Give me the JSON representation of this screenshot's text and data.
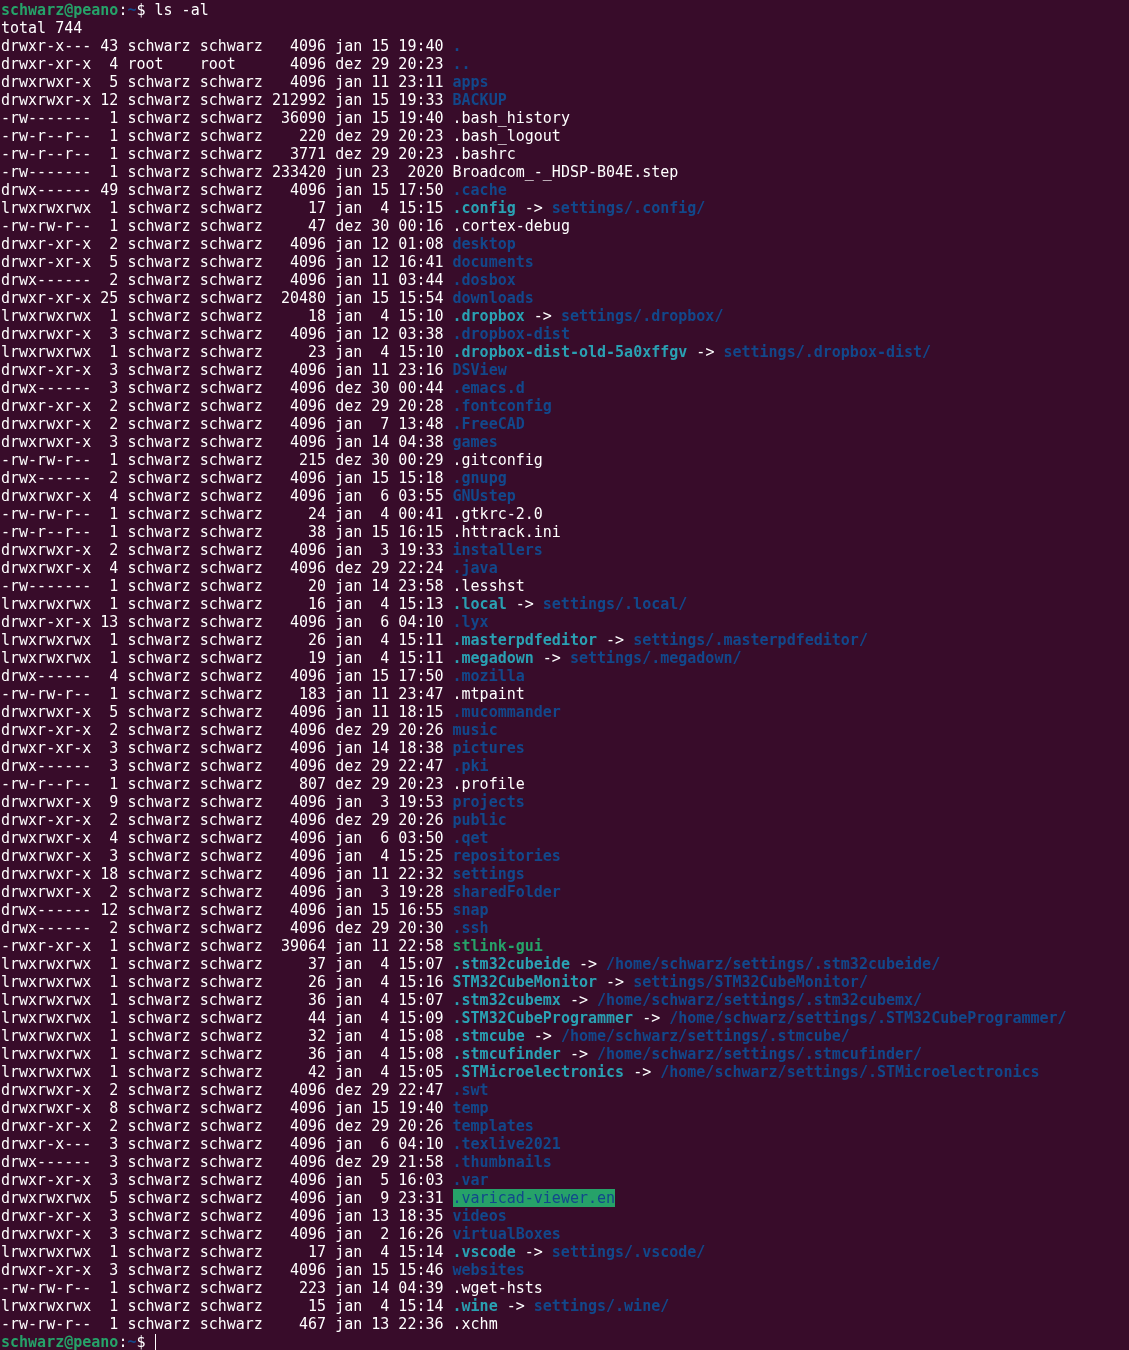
{
  "prompt": {
    "user_host": "schwarz@peano",
    "separator": ":",
    "path": "~",
    "symbol": "$",
    "command": "ls -al"
  },
  "total": "total 744",
  "entries": [
    {
      "info": "drwxr-x--- 43 schwarz schwarz   4096 jan 15 19:40",
      "name": ".",
      "kind": "dir"
    },
    {
      "info": "drwxr-xr-x  4 root    root      4096 dez 29 20:23",
      "name": "..",
      "kind": "dir"
    },
    {
      "info": "drwxrwxr-x  5 schwarz schwarz   4096 jan 11 23:11",
      "name": "apps",
      "kind": "dir"
    },
    {
      "info": "drwxrwxr-x 12 schwarz schwarz 212992 jan 15 19:33",
      "name": "BACKUP",
      "kind": "dir"
    },
    {
      "info": "-rw-------  1 schwarz schwarz  36090 jan 15 19:40",
      "name": ".bash_history",
      "kind": "file"
    },
    {
      "info": "-rw-r--r--  1 schwarz schwarz    220 dez 29 20:23",
      "name": ".bash_logout",
      "kind": "file"
    },
    {
      "info": "-rw-r--r--  1 schwarz schwarz   3771 dez 29 20:23",
      "name": ".bashrc",
      "kind": "file"
    },
    {
      "info": "-rw-------  1 schwarz schwarz 233420 jun 23  2020",
      "name": "Broadcom_-_HDSP-B04E.step",
      "kind": "file"
    },
    {
      "info": "drwx------ 49 schwarz schwarz   4096 jan 15 17:50",
      "name": ".cache",
      "kind": "dir"
    },
    {
      "info": "lrwxrwxrwx  1 schwarz schwarz     17 jan  4 15:15",
      "name": ".config",
      "kind": "link",
      "arrow": "->",
      "target": "settings/.config/"
    },
    {
      "info": "-rw-rw-r--  1 schwarz schwarz     47 dez 30 00:16",
      "name": ".cortex-debug",
      "kind": "file"
    },
    {
      "info": "drwxr-xr-x  2 schwarz schwarz   4096 jan 12 01:08",
      "name": "desktop",
      "kind": "dir"
    },
    {
      "info": "drwxr-xr-x  5 schwarz schwarz   4096 jan 12 16:41",
      "name": "documents",
      "kind": "dir"
    },
    {
      "info": "drwx------  2 schwarz schwarz   4096 jan 11 03:44",
      "name": ".dosbox",
      "kind": "dir"
    },
    {
      "info": "drwxr-xr-x 25 schwarz schwarz  20480 jan 15 15:54",
      "name": "downloads",
      "kind": "dir"
    },
    {
      "info": "lrwxrwxrwx  1 schwarz schwarz     18 jan  4 15:10",
      "name": ".dropbox",
      "kind": "link",
      "arrow": "->",
      "target": "settings/.dropbox/"
    },
    {
      "info": "drwxrwxr-x  3 schwarz schwarz   4096 jan 12 03:38",
      "name": ".dropbox-dist",
      "kind": "dir"
    },
    {
      "info": "lrwxrwxrwx  1 schwarz schwarz     23 jan  4 15:10",
      "name": ".dropbox-dist-old-5a0xffgv",
      "kind": "link",
      "arrow": "->",
      "target": "settings/.dropbox-dist/"
    },
    {
      "info": "drwxr-xr-x  3 schwarz schwarz   4096 jan 11 23:16",
      "name": "DSView",
      "kind": "dir"
    },
    {
      "info": "drwx------  3 schwarz schwarz   4096 dez 30 00:44",
      "name": ".emacs.d",
      "kind": "dir"
    },
    {
      "info": "drwxr-xr-x  2 schwarz schwarz   4096 dez 29 20:28",
      "name": ".fontconfig",
      "kind": "dir"
    },
    {
      "info": "drwxrwxr-x  2 schwarz schwarz   4096 jan  7 13:48",
      "name": ".FreeCAD",
      "kind": "dir"
    },
    {
      "info": "drwxrwxr-x  3 schwarz schwarz   4096 jan 14 04:38",
      "name": "games",
      "kind": "dir"
    },
    {
      "info": "-rw-rw-r--  1 schwarz schwarz    215 dez 30 00:29",
      "name": ".gitconfig",
      "kind": "file"
    },
    {
      "info": "drwx------  2 schwarz schwarz   4096 jan 15 15:18",
      "name": ".gnupg",
      "kind": "dir"
    },
    {
      "info": "drwxrwxr-x  4 schwarz schwarz   4096 jan  6 03:55",
      "name": "GNUstep",
      "kind": "dir"
    },
    {
      "info": "-rw-rw-r--  1 schwarz schwarz     24 jan  4 00:41",
      "name": ".gtkrc-2.0",
      "kind": "file"
    },
    {
      "info": "-rw-r--r--  1 schwarz schwarz     38 jan 15 16:15",
      "name": ".httrack.ini",
      "kind": "file"
    },
    {
      "info": "drwxrwxr-x  2 schwarz schwarz   4096 jan  3 19:33",
      "name": "installers",
      "kind": "dir"
    },
    {
      "info": "drwxrwxr-x  4 schwarz schwarz   4096 dez 29 22:24",
      "name": ".java",
      "kind": "dir"
    },
    {
      "info": "-rw-------  1 schwarz schwarz     20 jan 14 23:58",
      "name": ".lesshst",
      "kind": "file"
    },
    {
      "info": "lrwxrwxrwx  1 schwarz schwarz     16 jan  4 15:13",
      "name": ".local",
      "kind": "link",
      "arrow": "->",
      "target": "settings/.local/"
    },
    {
      "info": "drwxr-xr-x 13 schwarz schwarz   4096 jan  6 04:10",
      "name": ".lyx",
      "kind": "dir"
    },
    {
      "info": "lrwxrwxrwx  1 schwarz schwarz     26 jan  4 15:11",
      "name": ".masterpdfeditor",
      "kind": "link",
      "arrow": "->",
      "target": "settings/.masterpdfeditor/"
    },
    {
      "info": "lrwxrwxrwx  1 schwarz schwarz     19 jan  4 15:11",
      "name": ".megadown",
      "kind": "link",
      "arrow": "->",
      "target": "settings/.megadown/"
    },
    {
      "info": "drwx------  4 schwarz schwarz   4096 jan 15 17:50",
      "name": ".mozilla",
      "kind": "dir"
    },
    {
      "info": "-rw-rw-r--  1 schwarz schwarz    183 jan 11 23:47",
      "name": ".mtpaint",
      "kind": "file"
    },
    {
      "info": "drwxrwxr-x  5 schwarz schwarz   4096 jan 11 18:15",
      "name": ".mucommander",
      "kind": "dir"
    },
    {
      "info": "drwxr-xr-x  2 schwarz schwarz   4096 dez 29 20:26",
      "name": "music",
      "kind": "dir"
    },
    {
      "info": "drwxr-xr-x  3 schwarz schwarz   4096 jan 14 18:38",
      "name": "pictures",
      "kind": "dir"
    },
    {
      "info": "drwx------  3 schwarz schwarz   4096 dez 29 22:47",
      "name": ".pki",
      "kind": "dir"
    },
    {
      "info": "-rw-r--r--  1 schwarz schwarz    807 dez 29 20:23",
      "name": ".profile",
      "kind": "file"
    },
    {
      "info": "drwxrwxr-x  9 schwarz schwarz   4096 jan  3 19:53",
      "name": "projects",
      "kind": "dir"
    },
    {
      "info": "drwxr-xr-x  2 schwarz schwarz   4096 dez 29 20:26",
      "name": "public",
      "kind": "dir"
    },
    {
      "info": "drwxrwxr-x  4 schwarz schwarz   4096 jan  6 03:50",
      "name": ".qet",
      "kind": "dir"
    },
    {
      "info": "drwxrwxr-x  3 schwarz schwarz   4096 jan  4 15:25",
      "name": "repositories",
      "kind": "dir"
    },
    {
      "info": "drwxrwxr-x 18 schwarz schwarz   4096 jan 11 22:32",
      "name": "settings",
      "kind": "dir"
    },
    {
      "info": "drwxrwxr-x  2 schwarz schwarz   4096 jan  3 19:28",
      "name": "sharedFolder",
      "kind": "dir"
    },
    {
      "info": "drwx------ 12 schwarz schwarz   4096 jan 15 16:55",
      "name": "snap",
      "kind": "dir"
    },
    {
      "info": "drwx------  2 schwarz schwarz   4096 dez 29 20:30",
      "name": ".ssh",
      "kind": "dir"
    },
    {
      "info": "-rwxr-xr-x  1 schwarz schwarz  39064 jan 11 22:58",
      "name": "stlink-gui",
      "kind": "exec"
    },
    {
      "info": "lrwxrwxrwx  1 schwarz schwarz     37 jan  4 15:07",
      "name": ".stm32cubeide",
      "kind": "link",
      "arrow": "->",
      "target": "/home/schwarz/settings/.stm32cubeide/"
    },
    {
      "info": "lrwxrwxrwx  1 schwarz schwarz     26 jan  4 15:16",
      "name": "STM32CubeMonitor",
      "kind": "link",
      "arrow": "->",
      "target": "settings/STM32CubeMonitor/"
    },
    {
      "info": "lrwxrwxrwx  1 schwarz schwarz     36 jan  4 15:07",
      "name": ".stm32cubemx",
      "kind": "link",
      "arrow": "->",
      "target": "/home/schwarz/settings/.stm32cubemx/"
    },
    {
      "info": "lrwxrwxrwx  1 schwarz schwarz     44 jan  4 15:09",
      "name": ".STM32CubeProgrammer",
      "kind": "link",
      "arrow": "->",
      "target": "/home/schwarz/settings/.STM32CubeProgrammer/"
    },
    {
      "info": "lrwxrwxrwx  1 schwarz schwarz     32 jan  4 15:08",
      "name": ".stmcube",
      "kind": "link",
      "arrow": "->",
      "target": "/home/schwarz/settings/.stmcube/"
    },
    {
      "info": "lrwxrwxrwx  1 schwarz schwarz     36 jan  4 15:08",
      "name": ".stmcufinder",
      "kind": "link",
      "arrow": "->",
      "target": "/home/schwarz/settings/.stmcufinder/"
    },
    {
      "info": "lrwxrwxrwx  1 schwarz schwarz     42 jan  4 15:05",
      "name": ".STMicroelectronics",
      "kind": "link",
      "arrow": "->",
      "target": "/home/schwarz/settings/.STMicroelectronics"
    },
    {
      "info": "drwxrwxr-x  2 schwarz schwarz   4096 dez 29 22:47",
      "name": ".swt",
      "kind": "dir"
    },
    {
      "info": "drwxrwxr-x  8 schwarz schwarz   4096 jan 15 19:40",
      "name": "temp",
      "kind": "dir"
    },
    {
      "info": "drwxr-xr-x  2 schwarz schwarz   4096 dez 29 20:26",
      "name": "templates",
      "kind": "dir"
    },
    {
      "info": "drwxr-x---  3 schwarz schwarz   4096 jan  6 04:10",
      "name": ".texlive2021",
      "kind": "dir"
    },
    {
      "info": "drwx------  3 schwarz schwarz   4096 dez 29 21:58",
      "name": ".thumbnails",
      "kind": "dir"
    },
    {
      "info": "drwxr-xr-x  3 schwarz schwarz   4096 jan  5 16:03",
      "name": ".var",
      "kind": "dir"
    },
    {
      "info": "drwxrwxrwx  5 schwarz schwarz   4096 jan  9 23:31",
      "name": ".varicad-viewer.en",
      "kind": "world_writable_dir"
    },
    {
      "info": "drwxr-xr-x  3 schwarz schwarz   4096 jan 13 18:35",
      "name": "videos",
      "kind": "dir"
    },
    {
      "info": "drwxrwxr-x  3 schwarz schwarz   4096 jan  2 16:26",
      "name": "virtualBoxes",
      "kind": "dir"
    },
    {
      "info": "lrwxrwxrwx  1 schwarz schwarz     17 jan  4 15:14",
      "name": ".vscode",
      "kind": "link",
      "arrow": "->",
      "target": "settings/.vscode/"
    },
    {
      "info": "drwxr-xr-x  3 schwarz schwarz   4096 jan 15 15:46",
      "name": "websites",
      "kind": "dir"
    },
    {
      "info": "-rw-rw-r--  1 schwarz schwarz    223 jan 14 04:39",
      "name": ".wget-hsts",
      "kind": "file"
    },
    {
      "info": "lrwxrwxrwx  1 schwarz schwarz     15 jan  4 15:14",
      "name": ".wine",
      "kind": "link",
      "arrow": "->",
      "target": "settings/.wine/"
    },
    {
      "info": "-rw-rw-r--  1 schwarz schwarz    467 jan 13 22:36",
      "name": ".xchm",
      "kind": "file"
    }
  ],
  "final_prompt": {
    "user_host": "schwarz@peano",
    "separator": ":",
    "path": "~",
    "symbol": "$"
  }
}
